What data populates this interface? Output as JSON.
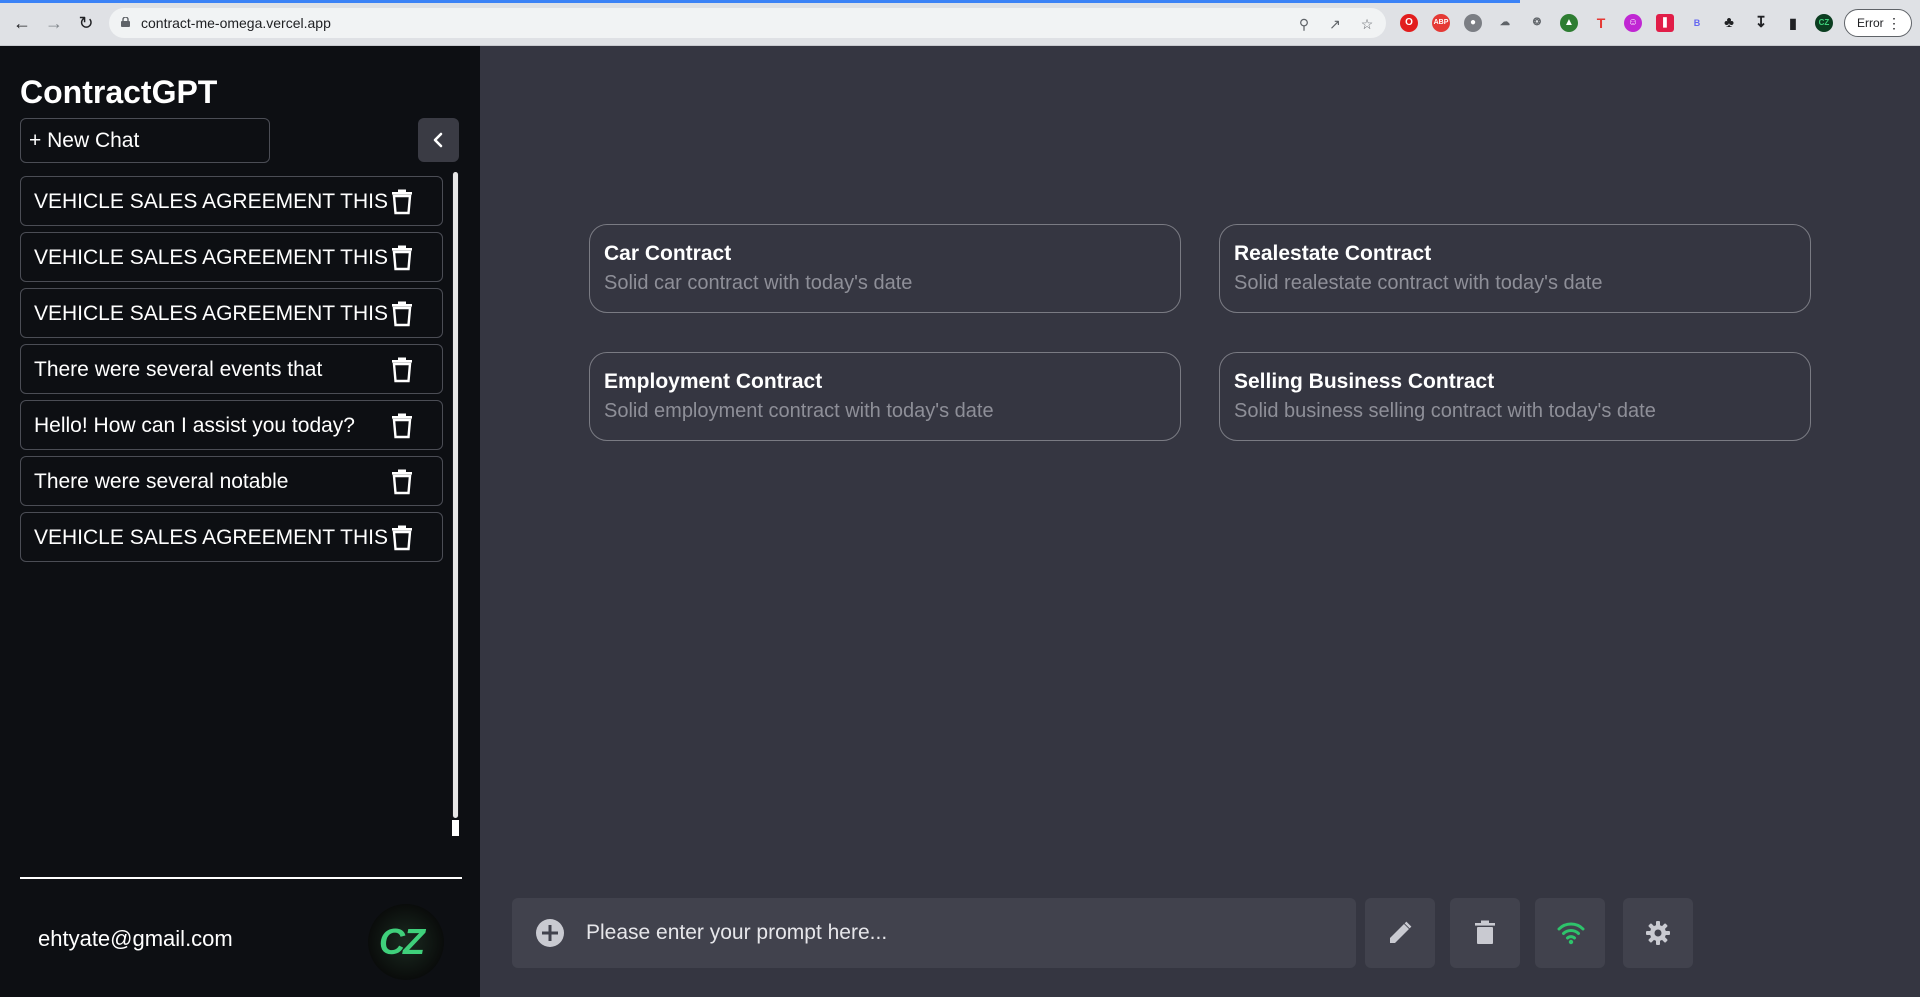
{
  "browser": {
    "url": "contract-me-omega.vercel.app",
    "error_label": "Error"
  },
  "sidebar": {
    "title": "ContractGPT",
    "new_chat_label": "+ New Chat",
    "chats": [
      {
        "text": "VEHICLE SALES AGREEMENT THIS"
      },
      {
        "text": "VEHICLE SALES AGREEMENT THIS"
      },
      {
        "text": "VEHICLE SALES AGREEMENT THIS"
      },
      {
        "text": "There were several events that"
      },
      {
        "text": "Hello! How can I assist you today?"
      },
      {
        "text": "There were several notable"
      },
      {
        "text": "VEHICLE SALES AGREEMENT THIS"
      }
    ],
    "user_email": "ehtyate@gmail.com",
    "avatar_text": "CZ"
  },
  "cards": [
    {
      "title": "Car Contract",
      "subtitle": "Solid car contract with today's date"
    },
    {
      "title": "Realestate Contract",
      "subtitle": "Solid realestate contract with today's date"
    },
    {
      "title": "Employment Contract",
      "subtitle": "Solid employment contract with today's date"
    },
    {
      "title": "Selling Business Contract",
      "subtitle": "Solid business selling contract with today's date"
    }
  ],
  "prompt": {
    "placeholder": "Please enter your prompt here...",
    "value": ""
  },
  "colors": {
    "sidebar_bg": "#0d0f13",
    "main_bg": "#353641",
    "input_bg": "#41424d",
    "wifi_green": "#2ec36b",
    "avatar_green": "#3fd07b"
  }
}
